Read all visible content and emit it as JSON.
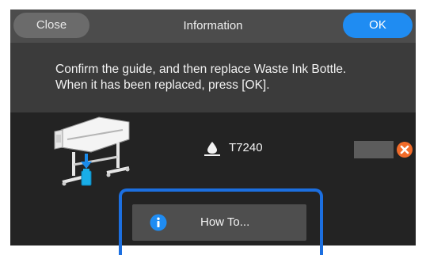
{
  "header": {
    "close_label": "Close",
    "title": "Information",
    "ok_label": "OK"
  },
  "message": {
    "line1": "Confirm the guide, and then replace Waste Ink Bottle.",
    "line2": "When it has been replaced, press [OK]."
  },
  "ink_status": {
    "icon": "ink-drop-icon",
    "code": "T7240",
    "status_icon": "error-x-icon",
    "status_color": "#f26c2a"
  },
  "howto": {
    "label": "How To...",
    "icon": "info-icon",
    "icon_color": "#1f8cf2"
  },
  "colors": {
    "ok_accent": "#1f8cf2",
    "highlight_frame": "#1c6fe0"
  }
}
